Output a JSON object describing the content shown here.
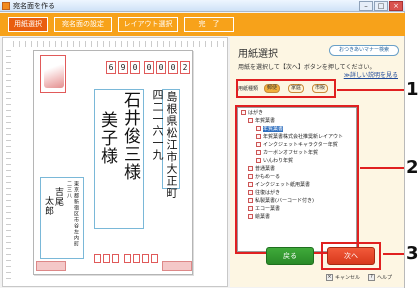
{
  "window": {
    "title": "宛名面を作る",
    "minimize": "–",
    "maximize": "□",
    "close": "×"
  },
  "steps": [
    {
      "label": "用紙選択"
    },
    {
      "label": "宛名面の設定"
    },
    {
      "label": "レイアウト選択"
    },
    {
      "label": "完　了"
    }
  ],
  "preview": {
    "zip": [
      "6",
      "9",
      "0",
      "0",
      "0",
      "0",
      "2"
    ],
    "address": "島根県松江市大正町",
    "address_number": "四二一六一九",
    "name_line1": "石井俊三様",
    "name_line2": "美子様",
    "sender_addr1": "東京都新宿区市谷左内町",
    "sender_addr2": "二三八",
    "sender_name": "吉尾",
    "sender_name2": "太郎"
  },
  "panel": {
    "title": "用紙選択",
    "help_button": "おつきあいマナー検索",
    "instruction": "用紙を選択して【次へ】ボタンを押してください。",
    "detail_link": "≫詳しい説明を見る",
    "category_label": "用紙種類",
    "category_options": [
      "郵便",
      "家庭",
      "市販"
    ],
    "tree": [
      "はがき",
      "年賀葉書",
      "年賀葉書",
      "年賀葉書株式会社推奨新レイアウト",
      "インクジェットキャラクター年賀",
      "カーボンオフセット年賀",
      "いんわり年賀",
      "普通葉書",
      "かもめーる",
      "インクジェット紙用葉書",
      "往復はがき",
      "私製葉書(バーコード付き)",
      "エコー葉書",
      "絵葉書"
    ],
    "back_label": "戻る",
    "next_label": "次へ",
    "cancel_label": "キャンセル",
    "help_label": "ヘルプ"
  },
  "callouts": [
    "1",
    "2",
    "3"
  ]
}
